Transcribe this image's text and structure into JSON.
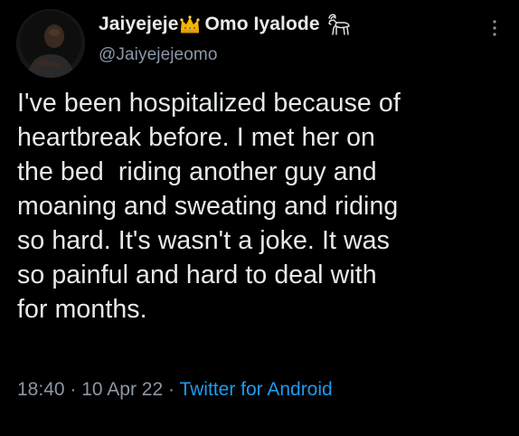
{
  "author": {
    "name_part1": "Jaiyejeje",
    "name_part2": "Omo Iyalode",
    "handle": "@Jaiyejejeomo",
    "crown_icon": "crown-emoji-icon",
    "goat_icon": "goat-icon"
  },
  "tweet": {
    "text": "I've been hospitalized because of\nheartbreak before. I met her on\nthe bed  riding another guy and\nmoaning and sweating and riding\nso hard. It's wasn't a joke. It was\nso painful and hard to deal with\nfor months."
  },
  "meta": {
    "time": "18:40",
    "separator1": "·",
    "date": "10 Apr 22",
    "separator2": "·",
    "source": "Twitter for Android"
  },
  "colors": {
    "background": "#000000",
    "text": "#e7e9ea",
    "secondary": "#8b98a5",
    "link": "#1d9bf0"
  }
}
